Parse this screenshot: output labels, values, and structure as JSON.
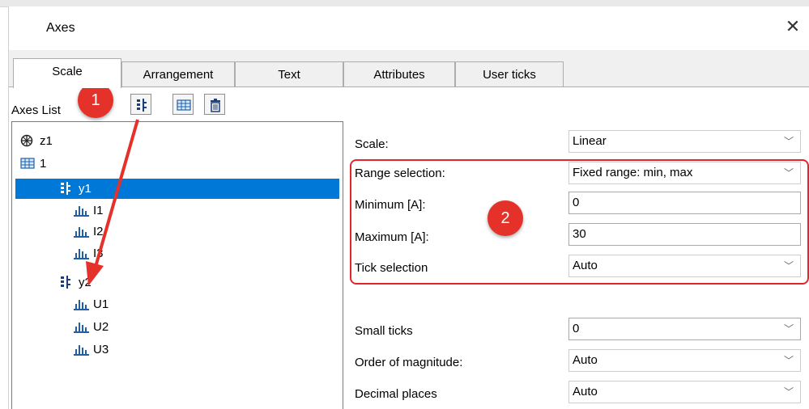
{
  "dialog": {
    "title": "Axes",
    "close_glyph": "✕"
  },
  "tabs": [
    {
      "label": "Scale",
      "active": true
    },
    {
      "label": "Arrangement"
    },
    {
      "label": "Text"
    },
    {
      "label": "Attributes"
    },
    {
      "label": "User ticks"
    }
  ],
  "axes_list": {
    "label": "Axes List",
    "toolbar": [
      "vertical-axis-icon",
      "grid-icon",
      "trash-icon"
    ],
    "tree": [
      {
        "label": "z1",
        "icon": "polar-axis-icon"
      },
      {
        "label": "1",
        "icon": "grid-icon"
      },
      {
        "label": "y1",
        "icon": "vertical-axis-icon",
        "selected": true
      },
      {
        "label": "I1",
        "icon": "bar-chart-icon"
      },
      {
        "label": "I2",
        "icon": "bar-chart-icon"
      },
      {
        "label": "I3",
        "icon": "bar-chart-icon"
      },
      {
        "label": "y2",
        "icon": "vertical-axis-icon"
      },
      {
        "label": "U1",
        "icon": "bar-chart-icon"
      },
      {
        "label": "U2",
        "icon": "bar-chart-icon"
      },
      {
        "label": "U3",
        "icon": "bar-chart-icon"
      }
    ]
  },
  "properties": {
    "scale": {
      "label": "Scale:",
      "value": "Linear"
    },
    "range_selection": {
      "label": "Range selection:",
      "value": "Fixed range: min, max"
    },
    "minimum": {
      "label": "Minimum [A]:",
      "value": "0"
    },
    "maximum": {
      "label": "Maximum [A]:",
      "value": "30"
    },
    "tick_selection": {
      "label": "Tick selection",
      "value": "Auto"
    },
    "small_ticks": {
      "label": "Small ticks",
      "value": "0"
    },
    "order_of_magnitude": {
      "label": "Order of magnitude:",
      "value": "Auto"
    },
    "decimal_places": {
      "label": "Decimal places",
      "value": "Auto"
    }
  },
  "annotations": {
    "badge_1": "1",
    "badge_2": "2",
    "accent_color": "#e4322b",
    "selection_color": "#0078d7"
  }
}
